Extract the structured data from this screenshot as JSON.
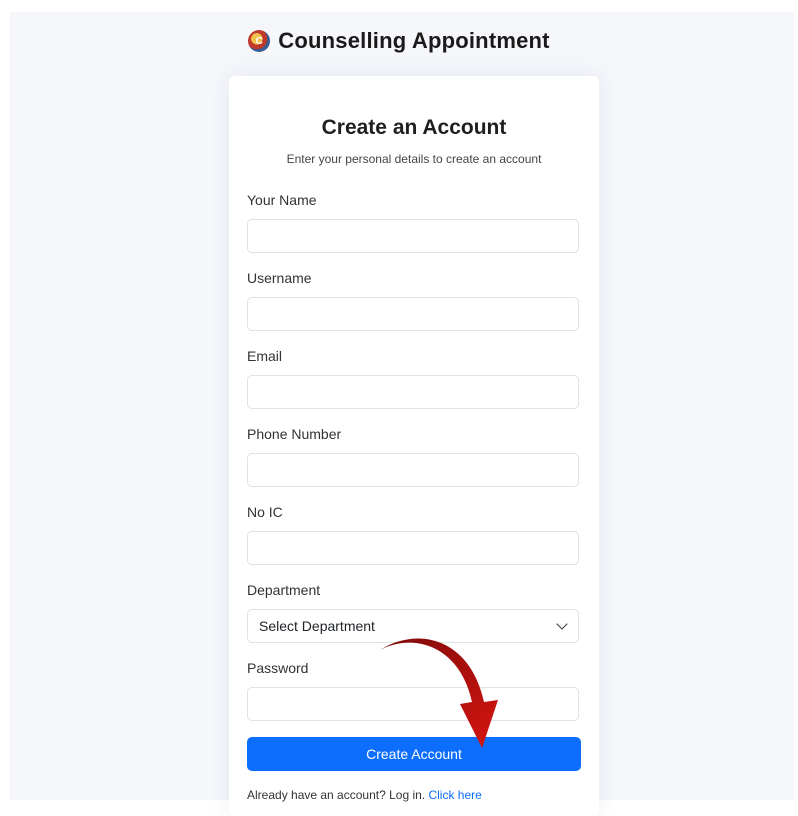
{
  "app": {
    "title": "Counselling Appointment",
    "logo_letter": "C"
  },
  "form": {
    "title": "Create an Account",
    "subtitle": "Enter your personal details to create an account",
    "fields": [
      {
        "label": "Your Name",
        "value": ""
      },
      {
        "label": "Username",
        "value": ""
      },
      {
        "label": "Email",
        "value": ""
      },
      {
        "label": "Phone Number",
        "value": ""
      },
      {
        "label": "No IC",
        "value": ""
      },
      {
        "label": "Department",
        "selected": "Select Department"
      },
      {
        "label": "Password",
        "value": ""
      }
    ],
    "submit_label": "Create Account",
    "login_prompt": "Already have an account? Log in.",
    "login_link": "Click here"
  },
  "colors": {
    "primary": "#0d6efd",
    "annotation_arrow": "#b0100f",
    "page_background": "#f5f7fb"
  },
  "icons": {
    "brand": "logo-icon",
    "select": "chevron-down-icon",
    "annotation": "curved-arrow-icon"
  }
}
